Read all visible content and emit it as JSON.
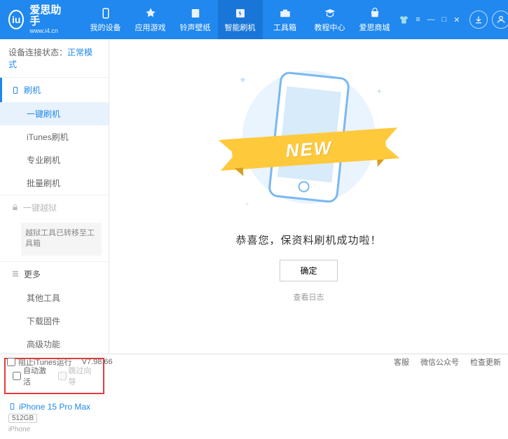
{
  "header": {
    "logo_letter": "iu",
    "title": "爱思助手",
    "url": "www.i4.cn",
    "nav": [
      {
        "label": "我的设备"
      },
      {
        "label": "应用游戏"
      },
      {
        "label": "铃声壁纸"
      },
      {
        "label": "智能刷机"
      },
      {
        "label": "工具箱"
      },
      {
        "label": "教程中心"
      },
      {
        "label": "爱思商城"
      }
    ]
  },
  "sidebar": {
    "status_label": "设备连接状态：",
    "status_value": "正常模式",
    "section_flash": "刷机",
    "items_flash": [
      "一键刷机",
      "iTunes刷机",
      "专业刷机",
      "批量刷机"
    ],
    "section_jailbreak": "一键越狱",
    "jailbreak_note": "越狱工具已转移至工具箱",
    "section_more": "更多",
    "items_more": [
      "其他工具",
      "下载固件",
      "高级功能"
    ],
    "auto_activate": "自动激活",
    "skip_guide": "跳过向导",
    "device_name": "iPhone 15 Pro Max",
    "device_storage": "512GB",
    "device_type": "iPhone"
  },
  "main": {
    "ribbon": "NEW",
    "success": "恭喜您，保资料刷机成功啦！",
    "ok": "确定",
    "view_log": "查看日志"
  },
  "statusbar": {
    "block_itunes": "阻止iTunes运行",
    "version": "V7.98.66",
    "links": [
      "客服",
      "微信公众号",
      "检查更新"
    ]
  }
}
